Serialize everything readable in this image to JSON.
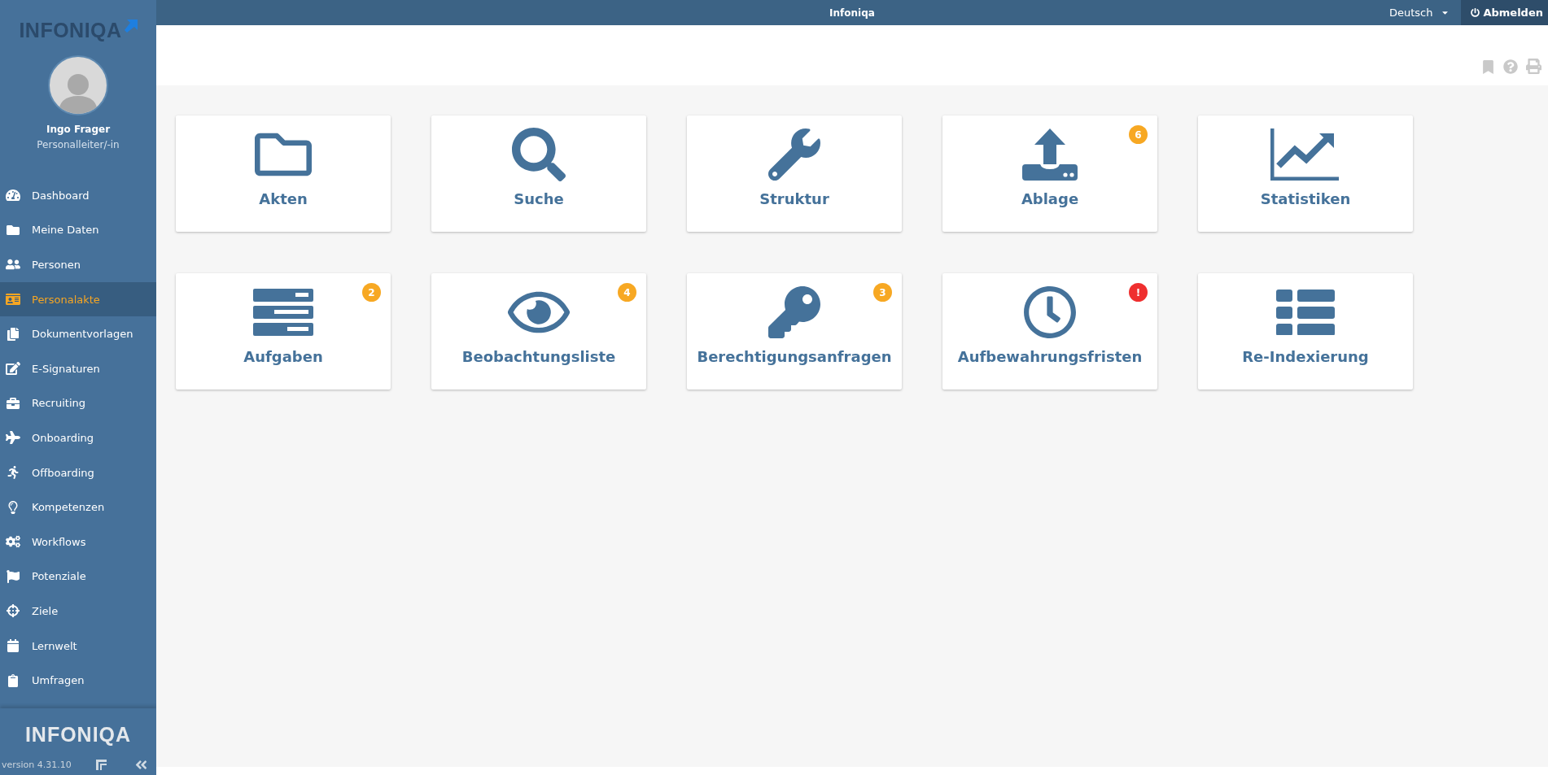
{
  "topbar": {
    "title": "Infoniqa",
    "language": "Deutsch",
    "logout": "Abmelden"
  },
  "sidebar": {
    "logo": "INFONIQA",
    "user": {
      "name": "Ingo Frager",
      "role": "Personalleiter/-in"
    },
    "items": [
      {
        "label": "Dashboard",
        "selected": false
      },
      {
        "label": "Meine Daten",
        "selected": false
      },
      {
        "label": "Personen",
        "selected": false
      },
      {
        "label": "Personalakte",
        "selected": true
      },
      {
        "label": "Dokumentvorlagen",
        "selected": false
      },
      {
        "label": "E-Signaturen",
        "selected": false
      },
      {
        "label": "Recruiting",
        "selected": false
      },
      {
        "label": "Onboarding",
        "selected": false
      },
      {
        "label": "Offboarding",
        "selected": false
      },
      {
        "label": "Kompetenzen",
        "selected": false
      },
      {
        "label": "Workflows",
        "selected": false
      },
      {
        "label": "Potenziale",
        "selected": false
      },
      {
        "label": "Ziele",
        "selected": false
      },
      {
        "label": "Lernwelt",
        "selected": false
      },
      {
        "label": "Umfragen",
        "selected": false
      }
    ],
    "footer_logo": "INFONIQA",
    "version": "version 4.31.10"
  },
  "tiles": [
    {
      "label": "Akten"
    },
    {
      "label": "Suche"
    },
    {
      "label": "Struktur"
    },
    {
      "label": "Ablage",
      "badge": {
        "text": "6",
        "kind": "count"
      }
    },
    {
      "label": "Statistiken"
    },
    {
      "label": "Aufgaben",
      "badge": {
        "text": "2",
        "kind": "count"
      }
    },
    {
      "label": "Beobachtungsliste",
      "badge": {
        "text": "4",
        "kind": "count"
      }
    },
    {
      "label": "Berechtigungsanfragen",
      "badge": {
        "text": "3",
        "kind": "count"
      }
    },
    {
      "label": "Aufbewahrungsfristen",
      "badge": {
        "text": "!",
        "kind": "alert"
      }
    },
    {
      "label": "Re-Indexierung"
    }
  ]
}
